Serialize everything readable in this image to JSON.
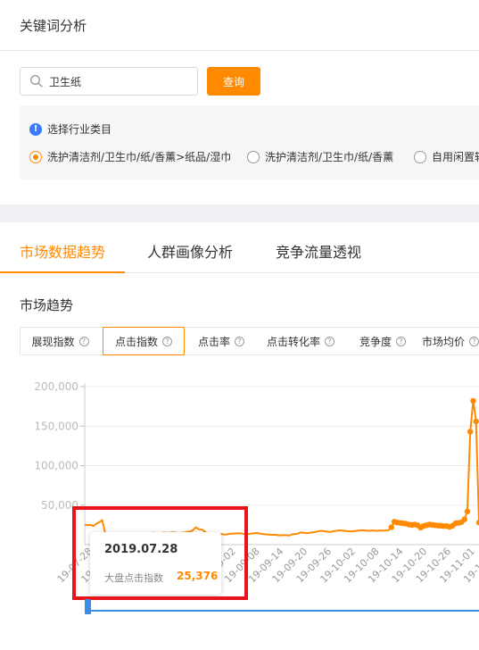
{
  "page_title": "关键词分析",
  "search": {
    "value": "卫生纸",
    "button": "查询"
  },
  "industry": {
    "heading": "选择行业类目",
    "options": [
      {
        "label": "洗护清洁剂/卫生巾/纸/香薰>纸品/湿巾",
        "checked": true
      },
      {
        "label": "洗护清洁剂/卫生巾/纸/香薰",
        "checked": false
      },
      {
        "label": "自用闲置转",
        "checked": false
      }
    ]
  },
  "main_tabs": [
    "市场数据趋势",
    "人群画像分析",
    "竞争流量透视"
  ],
  "active_main_tab": 0,
  "section_title": "市场趋势",
  "metric_tabs": [
    "展现指数",
    "点击指数",
    "点击率",
    "点击转化率",
    "竞争度",
    "市场均价"
  ],
  "active_metric_tab": 1,
  "tooltip": {
    "date": "2019.07.28",
    "label": "大盘点击指数",
    "value": "25,376"
  },
  "colors": {
    "accent": "#ff8a00",
    "highlight": "#e8141c",
    "info": "#3a7bff"
  },
  "chart_data": {
    "type": "line",
    "ylim": [
      0,
      200000
    ],
    "yticks": [
      "200,000",
      "150,000",
      "100,000",
      "50,000"
    ],
    "xticks": [
      "19-07-28",
      "19-08-03",
      "19-08-09",
      "19-08-15",
      "19-08-21",
      "19-08-27",
      "19-09-02",
      "19-09-08",
      "19-09-14",
      "19-09-20",
      "19-09-26",
      "19-10-02",
      "19-10-08",
      "19-10-14",
      "19-10-20",
      "19-10-26",
      "19-11-01",
      "19-11-07",
      "19-11-13"
    ],
    "series": [
      {
        "values": [
          25376,
          24500,
          25000,
          23500,
          26500,
          28500,
          31000,
          14500,
          14000,
          13500,
          13800,
          13200,
          13500,
          13000,
          13800,
          13500,
          13600,
          14000,
          14200,
          14500,
          14000,
          14600,
          14000,
          14800,
          15000,
          14600,
          14500,
          15200,
          15000,
          14800,
          15500,
          15200,
          14600,
          14800,
          15200,
          16000,
          16500,
          18000,
          22000,
          19500,
          19200,
          17000,
          13500,
          12500,
          13500,
          13000,
          13200,
          13500,
          12600,
          13200,
          13800,
          14000,
          14200,
          14500,
          14000,
          13200,
          13500,
          14000,
          14500,
          14800,
          14000,
          13500,
          13000,
          12600,
          12400,
          12500,
          12000,
          11800,
          12200,
          12000,
          11500,
          13000,
          13500,
          14000,
          15500,
          15000,
          14500,
          15000,
          15600,
          16000,
          17000,
          17500,
          17000,
          16500,
          16000,
          16800,
          17500,
          18000,
          17800,
          17500,
          17000,
          16800,
          17000,
          17500,
          18000,
          18200,
          18000,
          17500,
          17800,
          18000,
          17500,
          18000,
          17800,
          18000,
          18200,
          22000,
          29000,
          28000,
          27500,
          27000,
          26500,
          25500,
          25000,
          25500,
          24500,
          21500,
          23500,
          24500,
          25500,
          25000,
          24500,
          24000,
          23800,
          23500,
          23500,
          22500,
          24000,
          27000,
          27500,
          28500,
          32000,
          42000,
          143000,
          182000,
          156000,
          28000
        ],
        "visible_markers_from_index": 105
      }
    ]
  }
}
